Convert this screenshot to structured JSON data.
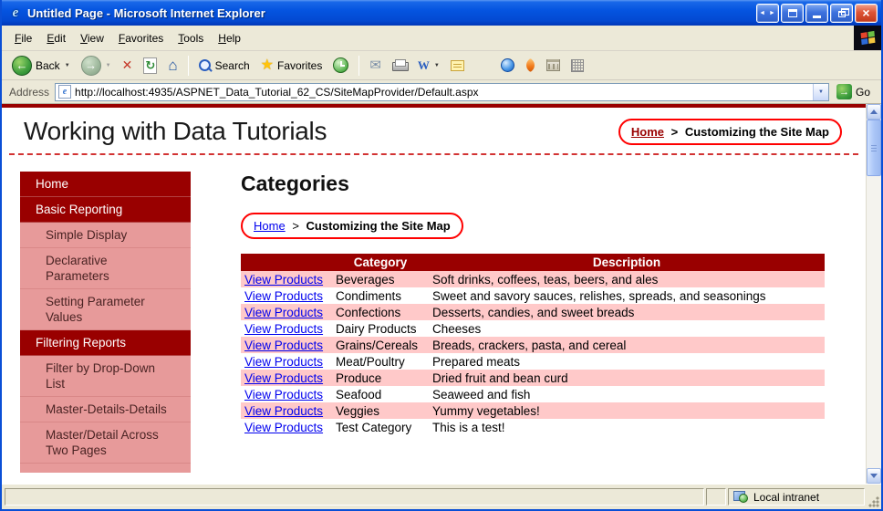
{
  "window": {
    "title": "Untitled Page - Microsoft Internet Explorer",
    "menu": [
      "File",
      "Edit",
      "View",
      "Favorites",
      "Tools",
      "Help"
    ],
    "address": {
      "label": "Address",
      "url": "http://localhost:4935/ASPNET_Data_Tutorial_62_CS/SiteMapProvider/Default.aspx",
      "go": "Go"
    },
    "status": {
      "zone": "Local intranet"
    }
  },
  "toolbar": {
    "back": "Back",
    "search": "Search",
    "favorites": "Favorites"
  },
  "icons": {
    "ie_logo": "e",
    "title_arrows": "◄ ►",
    "close": "×",
    "back_arrow": "←",
    "forward_arrow": "→",
    "stop": "✕",
    "refresh": "↻",
    "home": "⌂",
    "star": "★",
    "mail": "✉",
    "edit": "W",
    "dropdown": "▼",
    "go_arrow": "→"
  },
  "page": {
    "title": "Working with Data Tutorials",
    "heading": "Categories",
    "breadcrumb": {
      "home": "Home",
      "separator": ">",
      "current": "Customizing the Site Map"
    },
    "sidebar": [
      {
        "label": "Home",
        "level": 0
      },
      {
        "label": "Basic Reporting",
        "level": 0
      },
      {
        "label": "Simple Display",
        "level": 1
      },
      {
        "label": "Declarative Parameters",
        "level": 1
      },
      {
        "label": "Setting Parameter Values",
        "level": 1
      },
      {
        "label": "Filtering Reports",
        "level": 0
      },
      {
        "label": "Filter by Drop-Down List",
        "level": 1
      },
      {
        "label": "Master-Details-Details",
        "level": 1
      },
      {
        "label": "Master/Detail Across Two Pages",
        "level": 1
      }
    ],
    "table": {
      "headers": [
        "",
        "Category",
        "Description"
      ],
      "rows": [
        {
          "link": "View Products",
          "category": "Beverages",
          "description": "Soft drinks, coffees, teas, beers, and ales"
        },
        {
          "link": "View Products",
          "category": "Condiments",
          "description": "Sweet and savory sauces, relishes, spreads, and seasonings"
        },
        {
          "link": "View Products",
          "category": "Confections",
          "description": "Desserts, candies, and sweet breads"
        },
        {
          "link": "View Products",
          "category": "Dairy Products",
          "description": "Cheeses"
        },
        {
          "link": "View Products",
          "category": "Grains/Cereals",
          "description": "Breads, crackers, pasta, and cereal"
        },
        {
          "link": "View Products",
          "category": "Meat/Poultry",
          "description": "Prepared meats"
        },
        {
          "link": "View Products",
          "category": "Produce",
          "description": "Dried fruit and bean curd"
        },
        {
          "link": "View Products",
          "category": "Seafood",
          "description": "Seaweed and fish"
        },
        {
          "link": "View Products",
          "category": "Veggies",
          "description": "Yummy vegetables!"
        },
        {
          "link": "View Products",
          "category": "Test Category",
          "description": "This is a test!"
        }
      ]
    }
  },
  "colors": {
    "maroon": "#990000",
    "sidebar_pink": "#E79A9A",
    "row_pink": "#FFC9C9",
    "link_blue": "#0000EE",
    "annotation_red": "#FF0000",
    "dash_red": "#D23333",
    "chrome_tan": "#ECE9D8",
    "title_blue": "#0A4FD6",
    "back_green": "#2C8A33",
    "star_yellow": "#FFC30B"
  }
}
